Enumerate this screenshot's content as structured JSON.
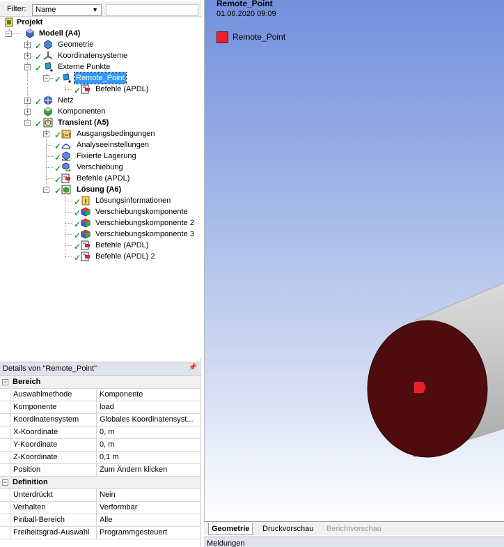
{
  "filter": {
    "label": "Filter:",
    "value": "Name"
  },
  "tree": {
    "projekt": "Projekt",
    "modell": "Modell (A4)",
    "geometrie": "Geometrie",
    "koordinatensysteme": "Koordinatensysteme",
    "externe_punkte": "Externe Punkte",
    "remote_point": "Remote_Point",
    "befehle_1": "Befehle (APDL)",
    "netz": "Netz",
    "komponenten": "Komponenten",
    "transient": "Transient (A5)",
    "ausgangsbedingungen": "Ausgangsbedingungen",
    "analyseeinstellungen": "Analyseeinstellungen",
    "fixierte_lagerung": "Fixierte Lagerung",
    "verschiebung": "Verschiebung",
    "befehle_2": "Befehle (APDL)",
    "loesung": "Lösung (A6)",
    "loesungsinformationen": "Lösungsinformationen",
    "vk1": "Verschiebungskomponente",
    "vk2": "Verschiebungskomponente 2",
    "vk3": "Verschiebungskomponente 3",
    "befehle_3": "Befehle (APDL)",
    "befehle_4": "Befehle (APDL) 2"
  },
  "details": {
    "title": "Details von \"Remote_Point\"",
    "sections": [
      {
        "name": "Bereich",
        "rows": [
          {
            "k": "Auswahlmethode",
            "v": "Komponente"
          },
          {
            "k": "Komponente",
            "v": "load"
          },
          {
            "k": "Koordinatensystem",
            "v": "Globales Koordinatensyst..."
          },
          {
            "k": "X-Koordinate",
            "v": "0, m"
          },
          {
            "k": "Y-Koordinate",
            "v": "0, m"
          },
          {
            "k": "Z-Koordinate",
            "v": "0,1 m"
          },
          {
            "k": "Position",
            "v": "Zum Ändern klicken"
          }
        ]
      },
      {
        "name": "Definition",
        "rows": [
          {
            "k": "Unterdrückt",
            "v": "Nein"
          },
          {
            "k": "Verhalten",
            "v": "Verformbar"
          },
          {
            "k": "Pinball-Bereich",
            "v": "Alle"
          },
          {
            "k": "Freiheitsgrad-Auswahl",
            "v": "Programmgesteuert"
          }
        ]
      }
    ]
  },
  "viewport": {
    "title": "Remote_Point",
    "date": "01.06.2020 09:09",
    "legend_label": "Remote_Point",
    "legend_color": "#e8202a"
  },
  "tabs": {
    "geometrie": "Geometrie",
    "druckvorschau": "Druckvorschau",
    "berichtvorschau": "Berichtvorschau"
  },
  "status": {
    "meldungen": "Meldungen"
  }
}
